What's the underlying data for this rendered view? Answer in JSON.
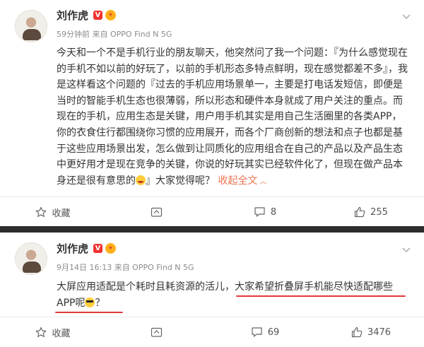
{
  "posts": [
    {
      "username": "刘作虎",
      "vip_badge": "V",
      "meta": "59分钟前  来自 OPPO Find N 5G",
      "text_pre": "今天和一个不是手机行业的朋友聊天，他突然问了我一个问题：『为什么感觉现在的手机不如以前的好玩了，以前的手机形态多特点鲜明，现在感觉都差不多』，我是这样看这个问题的『过去的手机应用场景单一，主要是打电话发短信，即便是当时的智能手机生态也很薄弱，所以形态和硬件本身就成了用户关注的重点。而现在的手机，应用生态是关键，用户用手机其实是用自己生活圈里的各类APP，你的衣食住行都围绕你习惯的应用展开，而各个厂商创新的想法和点子也都是基于这些应用场景出发，怎么做到让同质化的应用组合在自己的产品以及产品生态中更好用才是现在竞争的关键，你说的好玩其实已经软件化了，但现在做产品本身还是很有意思的",
      "text_post": "』大家觉得呢？",
      "collapse_label": "收起全文",
      "actions": {
        "favorite": "收藏",
        "repost": "",
        "comment": "8",
        "like": "255"
      }
    },
    {
      "username": "刘作虎",
      "vip_badge": "V",
      "meta": "9月14日 16:13  来自 OPPO Find N 5G",
      "text_pre": "大屏应用适配是个耗时且耗资源的活儿，",
      "text_highlight": "大家希望折叠屏手机能尽快适配哪些APP呢",
      "text_post": "？",
      "actions": {
        "favorite": "收藏",
        "repost": "",
        "comment": "69",
        "like": "3476"
      }
    }
  ],
  "colors": {
    "accent_link": "#eb7350",
    "highlight_underline": "#e2393b",
    "vip_badge": "#f0332f",
    "separator": "#2d2d2f"
  },
  "icons": [
    "avatar",
    "vip-badge-icon",
    "cheer-badge-icon",
    "more-chevron-icon",
    "star-icon",
    "repost-icon",
    "comment-icon",
    "like-icon",
    "grin-emoji-icon",
    "sunglasses-emoji-icon"
  ]
}
